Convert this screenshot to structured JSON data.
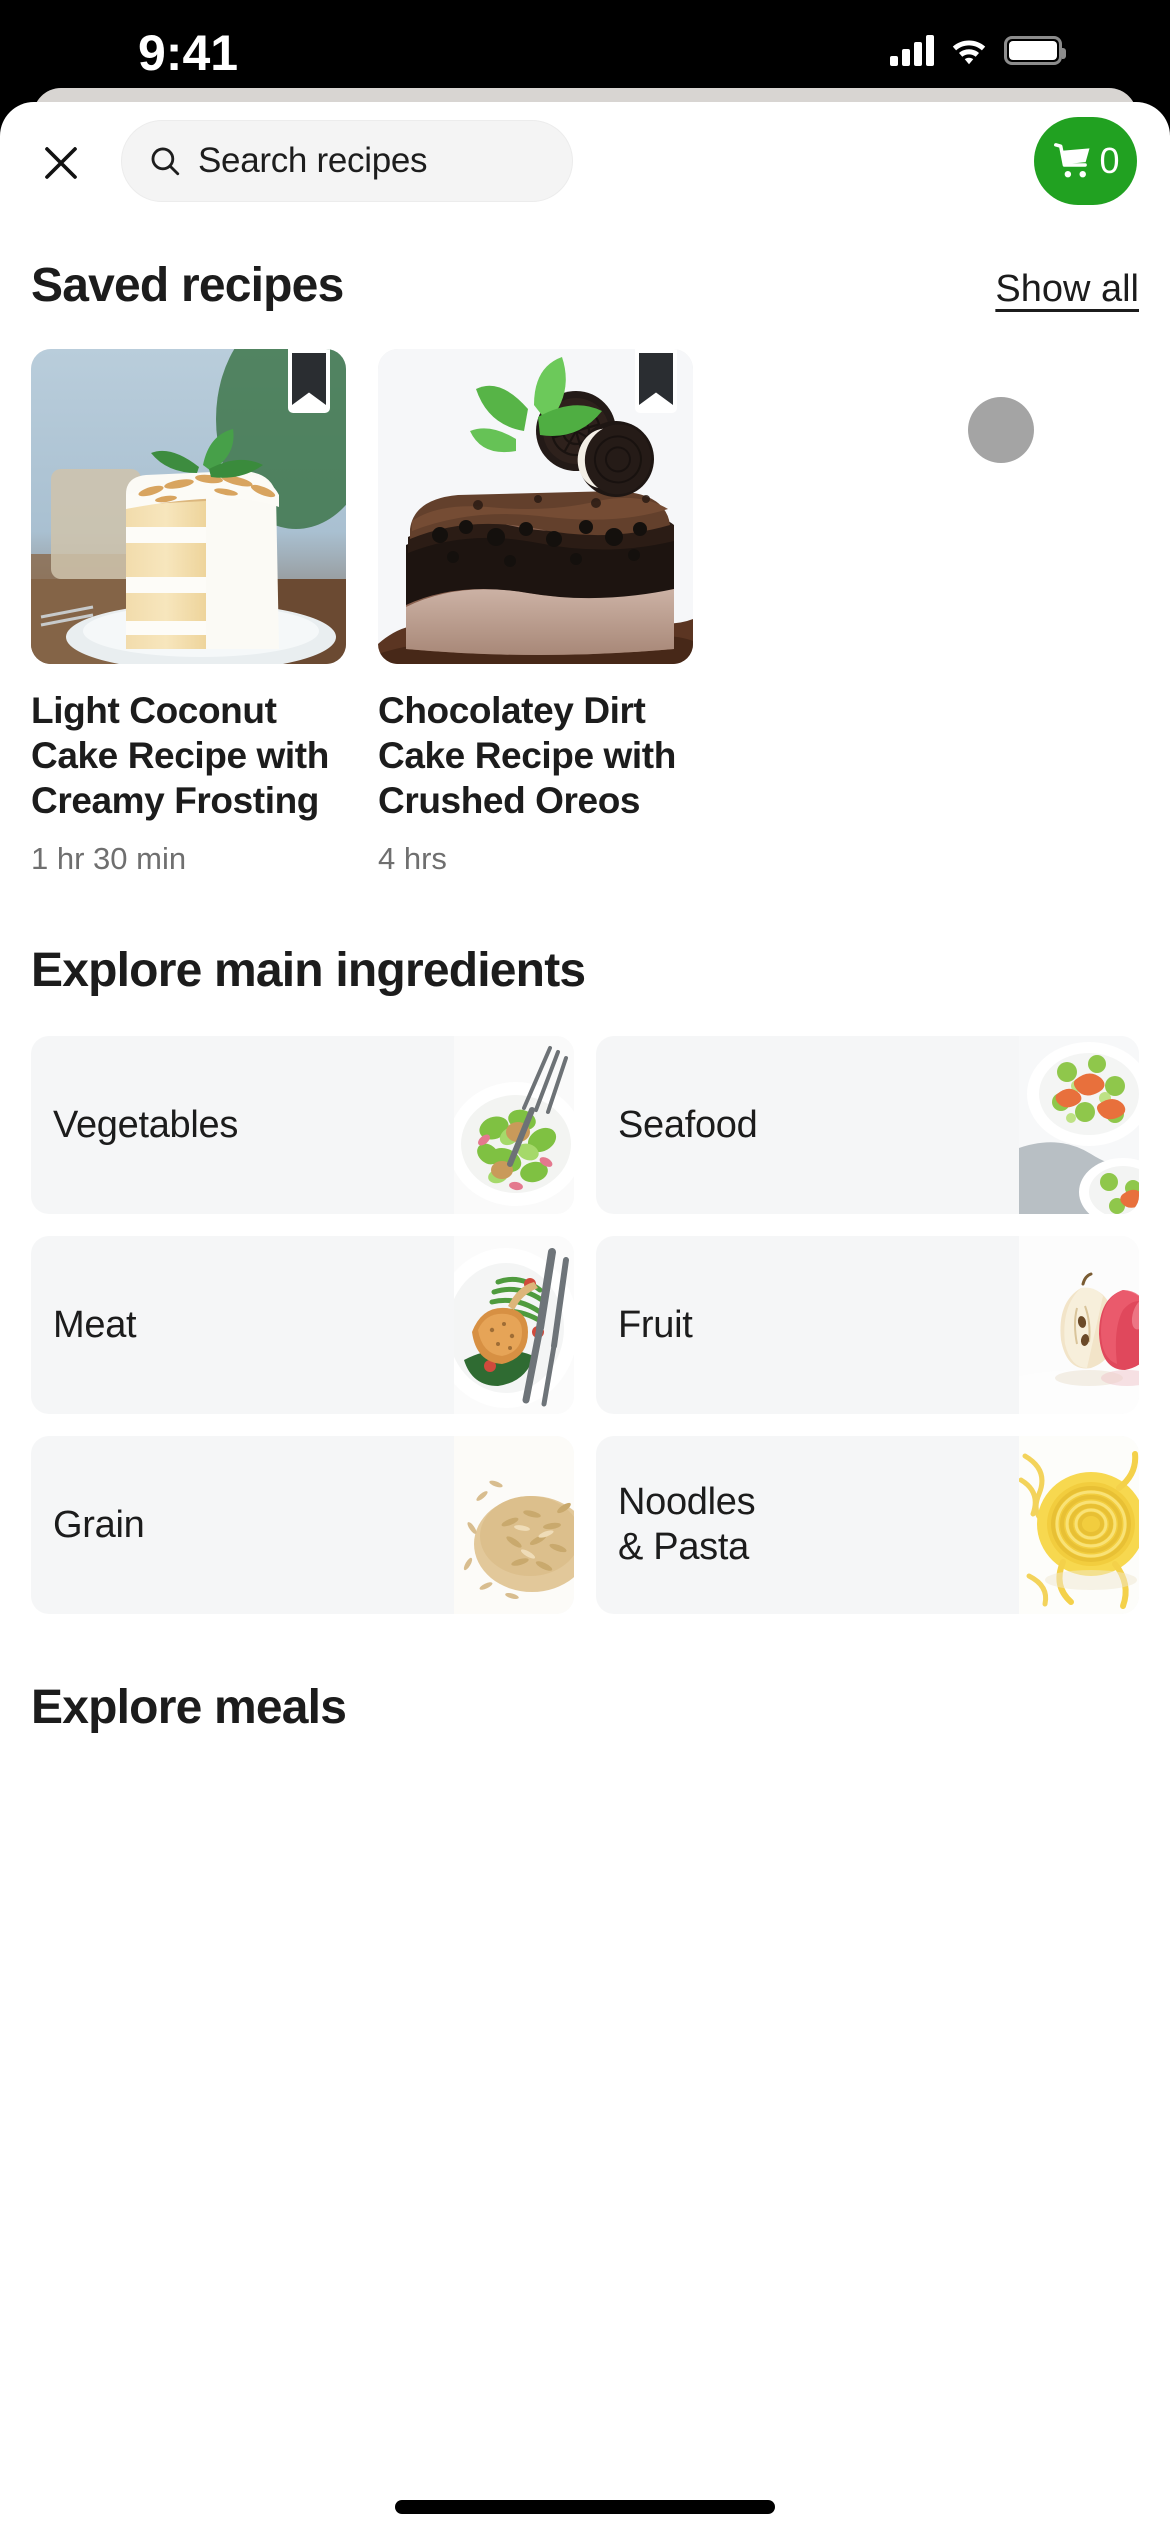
{
  "status_bar": {
    "time": "9:41",
    "cellular_icon": "cellular-bars-icon",
    "wifi_icon": "wifi-icon",
    "battery_icon": "battery-full-icon"
  },
  "header": {
    "close_icon": "close-x-icon",
    "search": {
      "icon": "search-icon",
      "value": "",
      "placeholder": "Search recipes"
    },
    "cart": {
      "icon": "shopping-cart-icon",
      "count": "0",
      "color": "#21a121"
    }
  },
  "saved_recipes": {
    "title": "Saved recipes",
    "show_all_label": "Show all",
    "items": [
      {
        "title": "Light Coconut Cake Recipe with Creamy Frosting",
        "time": "1 hr 30 min",
        "bookmark_icon": "bookmark-filled-icon",
        "image": "coconut-layer-cake-photo"
      },
      {
        "title": "Chocolatey Dirt Cake Recipe with Crushed Oreos",
        "time": "4 hrs",
        "bookmark_icon": "bookmark-filled-icon",
        "image": "chocolate-dirt-cake-photo"
      }
    ]
  },
  "explore_ingredients": {
    "title": "Explore main ingredients",
    "items": [
      {
        "label": "Vegetables",
        "image": "green-salad-plate-photo"
      },
      {
        "label": "Seafood",
        "image": "shrimp-cucumber-salad-photo"
      },
      {
        "label": "Meat",
        "image": "pork-chop-green-beans-photo"
      },
      {
        "label": "Fruit",
        "image": "sliced-apples-photo"
      },
      {
        "label": "Grain",
        "image": "brown-rice-grains-photo"
      },
      {
        "label": "Noodles & Pasta",
        "image": "fettuccine-nests-photo"
      }
    ]
  },
  "explore_meals": {
    "title": "Explore meals"
  }
}
